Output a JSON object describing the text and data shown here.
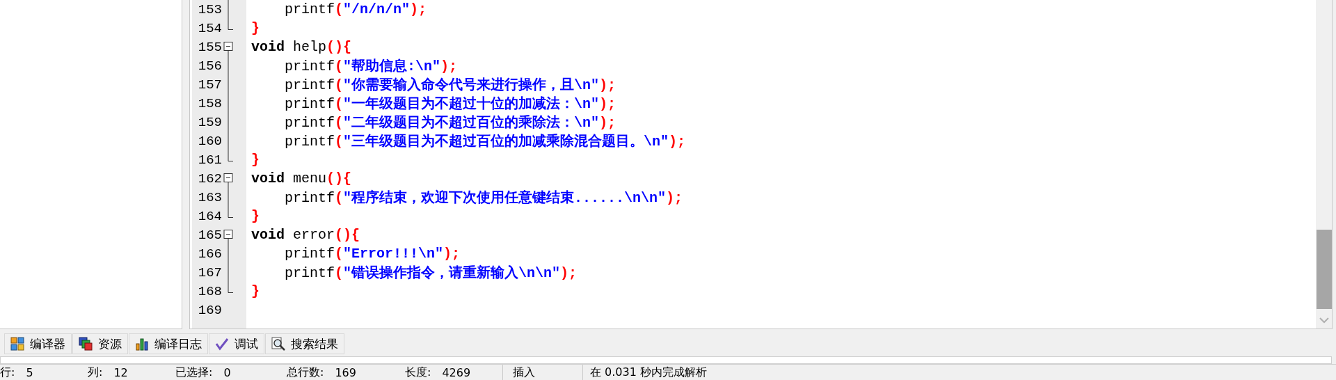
{
  "editor": {
    "lines": [
      {
        "number": "153",
        "kind": "mid",
        "tokens": [
          {
            "kind": "plain",
            "text": "    printf"
          },
          {
            "kind": "symbol",
            "text": "("
          },
          {
            "kind": "string",
            "text": "\"/n/n/n\""
          },
          {
            "kind": "symbol",
            "text": ");"
          }
        ]
      },
      {
        "number": "154",
        "kind": "end",
        "tokens": [
          {
            "kind": "symbol",
            "text": "}"
          }
        ]
      },
      {
        "number": "155",
        "kind": "start",
        "tokens": [
          {
            "kind": "keyword",
            "text": "void"
          },
          {
            "kind": "plain",
            "text": " help"
          },
          {
            "kind": "symbol",
            "text": "(){"
          }
        ]
      },
      {
        "number": "156",
        "kind": "mid",
        "tokens": [
          {
            "kind": "plain",
            "text": "    printf"
          },
          {
            "kind": "symbol",
            "text": "("
          },
          {
            "kind": "string",
            "text": "\"帮助信息:\\n\""
          },
          {
            "kind": "symbol",
            "text": ");"
          }
        ]
      },
      {
        "number": "157",
        "kind": "mid",
        "tokens": [
          {
            "kind": "plain",
            "text": "    printf"
          },
          {
            "kind": "symbol",
            "text": "("
          },
          {
            "kind": "string",
            "text": "\"你需要输入命令代号来进行操作，且\\n\""
          },
          {
            "kind": "symbol",
            "text": ");"
          }
        ]
      },
      {
        "number": "158",
        "kind": "mid",
        "tokens": [
          {
            "kind": "plain",
            "text": "    printf"
          },
          {
            "kind": "symbol",
            "text": "("
          },
          {
            "kind": "string",
            "text": "\"一年级题目为不超过十位的加减法：\\n\""
          },
          {
            "kind": "symbol",
            "text": ");"
          }
        ]
      },
      {
        "number": "159",
        "kind": "mid",
        "tokens": [
          {
            "kind": "plain",
            "text": "    printf"
          },
          {
            "kind": "symbol",
            "text": "("
          },
          {
            "kind": "string",
            "text": "\"二年级题目为不超过百位的乘除法：\\n\""
          },
          {
            "kind": "symbol",
            "text": ");"
          }
        ]
      },
      {
        "number": "160",
        "kind": "mid",
        "tokens": [
          {
            "kind": "plain",
            "text": "    printf"
          },
          {
            "kind": "symbol",
            "text": "("
          },
          {
            "kind": "string",
            "text": "\"三年级题目为不超过百位的加减乘除混合题目。\\n\""
          },
          {
            "kind": "symbol",
            "text": ");"
          }
        ]
      },
      {
        "number": "161",
        "kind": "end",
        "tokens": [
          {
            "kind": "symbol",
            "text": "}"
          }
        ]
      },
      {
        "number": "162",
        "kind": "start",
        "tokens": [
          {
            "kind": "keyword",
            "text": "void"
          },
          {
            "kind": "plain",
            "text": " menu"
          },
          {
            "kind": "symbol",
            "text": "(){"
          }
        ]
      },
      {
        "number": "163",
        "kind": "mid",
        "tokens": [
          {
            "kind": "plain",
            "text": "    printf"
          },
          {
            "kind": "symbol",
            "text": "("
          },
          {
            "kind": "string",
            "text": "\"程序结束，欢迎下次使用任意键结束......\\n\\n\""
          },
          {
            "kind": "symbol",
            "text": ");"
          }
        ]
      },
      {
        "number": "164",
        "kind": "end",
        "tokens": [
          {
            "kind": "symbol",
            "text": "}"
          }
        ]
      },
      {
        "number": "165",
        "kind": "start",
        "tokens": [
          {
            "kind": "keyword",
            "text": "void"
          },
          {
            "kind": "plain",
            "text": " error"
          },
          {
            "kind": "symbol",
            "text": "(){"
          }
        ]
      },
      {
        "number": "166",
        "kind": "mid",
        "tokens": [
          {
            "kind": "plain",
            "text": "    printf"
          },
          {
            "kind": "symbol",
            "text": "("
          },
          {
            "kind": "string",
            "text": "\"Error!!!\\n\""
          },
          {
            "kind": "symbol",
            "text": ");"
          }
        ]
      },
      {
        "number": "167",
        "kind": "mid",
        "tokens": [
          {
            "kind": "plain",
            "text": "    printf"
          },
          {
            "kind": "symbol",
            "text": "("
          },
          {
            "kind": "string",
            "text": "\"错误操作指令，请重新输入\\n\\n\""
          },
          {
            "kind": "symbol",
            "text": ");"
          }
        ]
      },
      {
        "number": "168",
        "kind": "end",
        "tokens": [
          {
            "kind": "symbol",
            "text": "}"
          }
        ]
      },
      {
        "number": "169"
      }
    ]
  },
  "bottom_tabs": [
    {
      "label": "编译器"
    },
    {
      "label": "资源"
    },
    {
      "label": "编译日志"
    },
    {
      "label": "调试"
    },
    {
      "label": "搜索结果"
    }
  ],
  "status_bar": [
    {
      "label": "行:",
      "value": "5"
    },
    {
      "label": "列:",
      "value": "12"
    },
    {
      "label": "已选择:",
      "value": "0"
    },
    {
      "label": "总行数:",
      "value": "169"
    },
    {
      "label": "长度:",
      "value": "4269"
    },
    {
      "value": "插入"
    },
    {
      "value": "在 0.031 秒内完成解析"
    }
  ]
}
